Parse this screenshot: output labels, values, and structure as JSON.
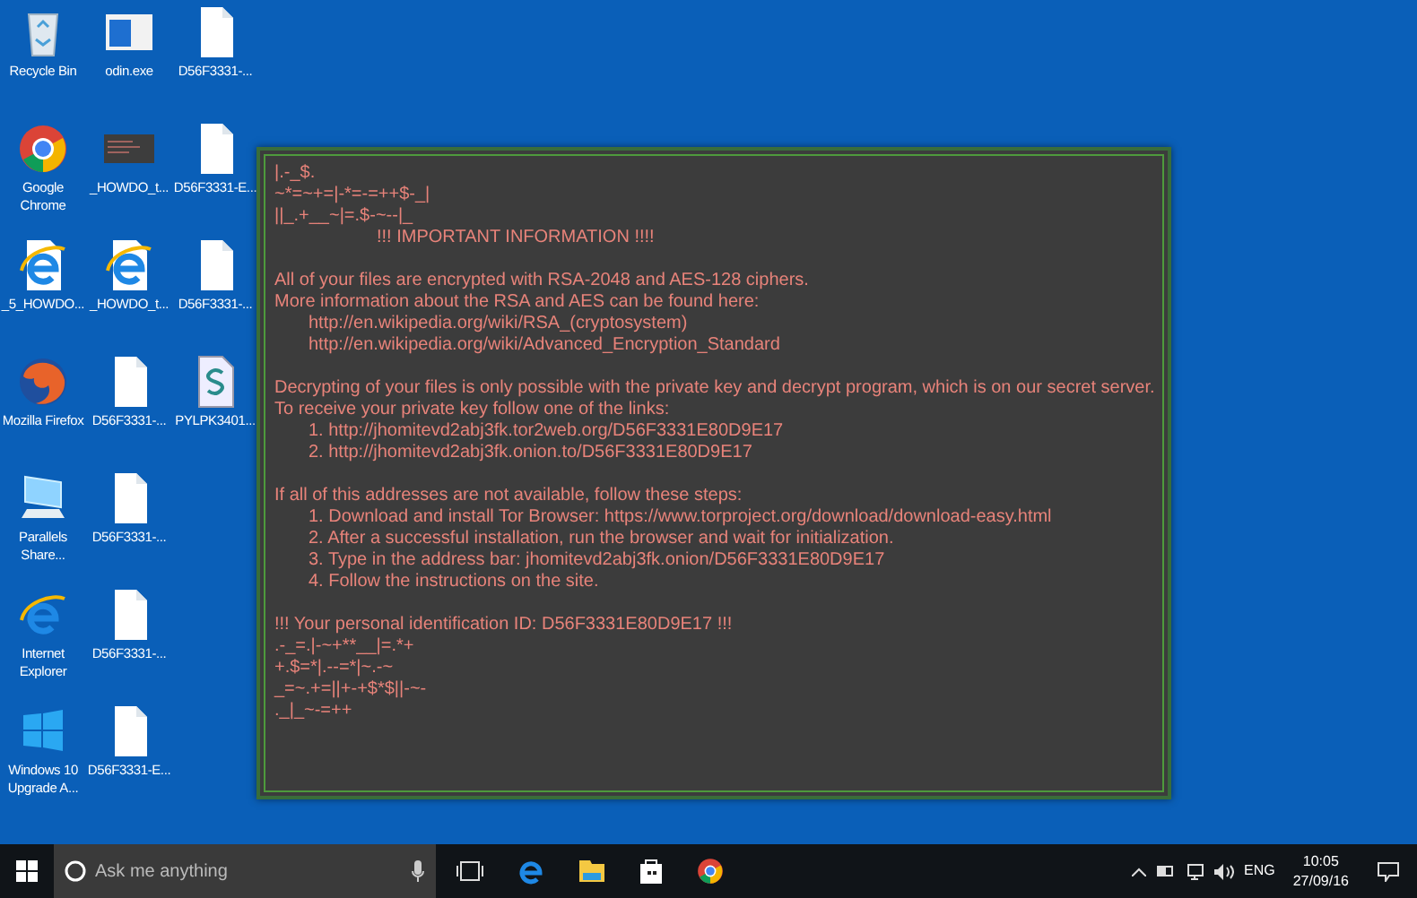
{
  "desktop": {
    "columns": [
      [
        {
          "label": "Recycle Bin",
          "kind": "recycle"
        },
        {
          "label": "Google Chrome",
          "kind": "chrome"
        },
        {
          "label": "_5_HOWDO...",
          "kind": "ie-doc"
        },
        {
          "label": "Mozilla Firefox",
          "kind": "firefox"
        },
        {
          "label": "Parallels Share...",
          "kind": "monitor"
        },
        {
          "label": "Internet Explorer",
          "kind": "ie"
        },
        {
          "label": "Windows 10 Upgrade A...",
          "kind": "windows"
        }
      ],
      [
        {
          "label": "odin.exe",
          "kind": "exe"
        },
        {
          "label": "_HOWDO_t...",
          "kind": "note"
        },
        {
          "label": "_HOWDO_t...",
          "kind": "ie-doc"
        },
        {
          "label": "D56F3331-...",
          "kind": "file"
        },
        {
          "label": "D56F3331-...",
          "kind": "file"
        },
        {
          "label": "D56F3331-...",
          "kind": "file"
        },
        {
          "label": "D56F3331-E...",
          "kind": "file"
        }
      ],
      [
        {
          "label": "D56F3331-...",
          "kind": "file"
        },
        {
          "label": "D56F3331-E...",
          "kind": "file"
        },
        {
          "label": "D56F3331-...",
          "kind": "file"
        },
        {
          "label": "PYLPK3401...",
          "kind": "script"
        }
      ]
    ]
  },
  "note": {
    "paragraphs": [
      [
        {
          "text": "|.-_$.",
          "kind": "plain"
        },
        {
          "text": "~*=~+=|-*=-=++$-_|",
          "kind": "plain"
        },
        {
          "text": "||_.+__~|=.$-~--|_",
          "kind": "plain"
        },
        {
          "text": "!!! IMPORTANT INFORMATION !!!!",
          "kind": "heading"
        }
      ],
      [
        {
          "text": "All of your files are encrypted with RSA-2048 and AES-128 ciphers.",
          "kind": "plain"
        },
        {
          "text": "More information about the RSA and AES can be found here:",
          "kind": "plain"
        },
        {
          "text": "http://en.wikipedia.org/wiki/RSA_(cryptosystem)",
          "kind": "indented"
        },
        {
          "text": "http://en.wikipedia.org/wiki/Advanced_Encryption_Standard",
          "kind": "indented"
        }
      ],
      [
        {
          "text": "Decrypting of your files is only possible with the private key and decrypt program, which is on our secret server.",
          "kind": "plain"
        },
        {
          "text": "To receive your private key follow one of the links:",
          "kind": "plain"
        },
        {
          "text": "1. http://jhomitevd2abj3fk.tor2web.org/D56F3331E80D9E17",
          "kind": "indented"
        },
        {
          "text": "2. http://jhomitevd2abj3fk.onion.to/D56F3331E80D9E17",
          "kind": "indented"
        }
      ],
      [
        {
          "text": "If all of this addresses are not available, follow these steps:",
          "kind": "plain"
        },
        {
          "text": "1. Download and install Tor Browser: https://www.torproject.org/download/download-easy.html",
          "kind": "indented"
        },
        {
          "text": "2. After a successful installation, run the browser and wait for initialization.",
          "kind": "indented"
        },
        {
          "text": "3. Type in the address bar: jhomitevd2abj3fk.onion/D56F3331E80D9E17",
          "kind": "indented"
        },
        {
          "text": "4. Follow the instructions on the site.",
          "kind": "indented"
        }
      ],
      [
        {
          "text": "!!! Your personal identification ID: D56F3331E80D9E17 !!!",
          "kind": "plain"
        },
        {
          "text": ".-_=.|-~+**__|=.*+",
          "kind": "plain"
        },
        {
          "text": "+.$=*|.--=*|~.-~",
          "kind": "plain"
        },
        {
          "text": "_=~.+=||+-+$*$||-~-",
          "kind": "plain"
        },
        {
          "text": "._|_~-=++",
          "kind": "plain"
        }
      ]
    ]
  },
  "taskbar": {
    "search": {
      "placeholder": "Ask me anything"
    },
    "apps": [
      {
        "kind": "taskview"
      },
      {
        "kind": "edge"
      },
      {
        "kind": "explorer"
      },
      {
        "kind": "store"
      },
      {
        "kind": "chrome"
      }
    ],
    "tray": {
      "language": "ENG",
      "time": "10:05",
      "date": "27/09/16"
    }
  }
}
